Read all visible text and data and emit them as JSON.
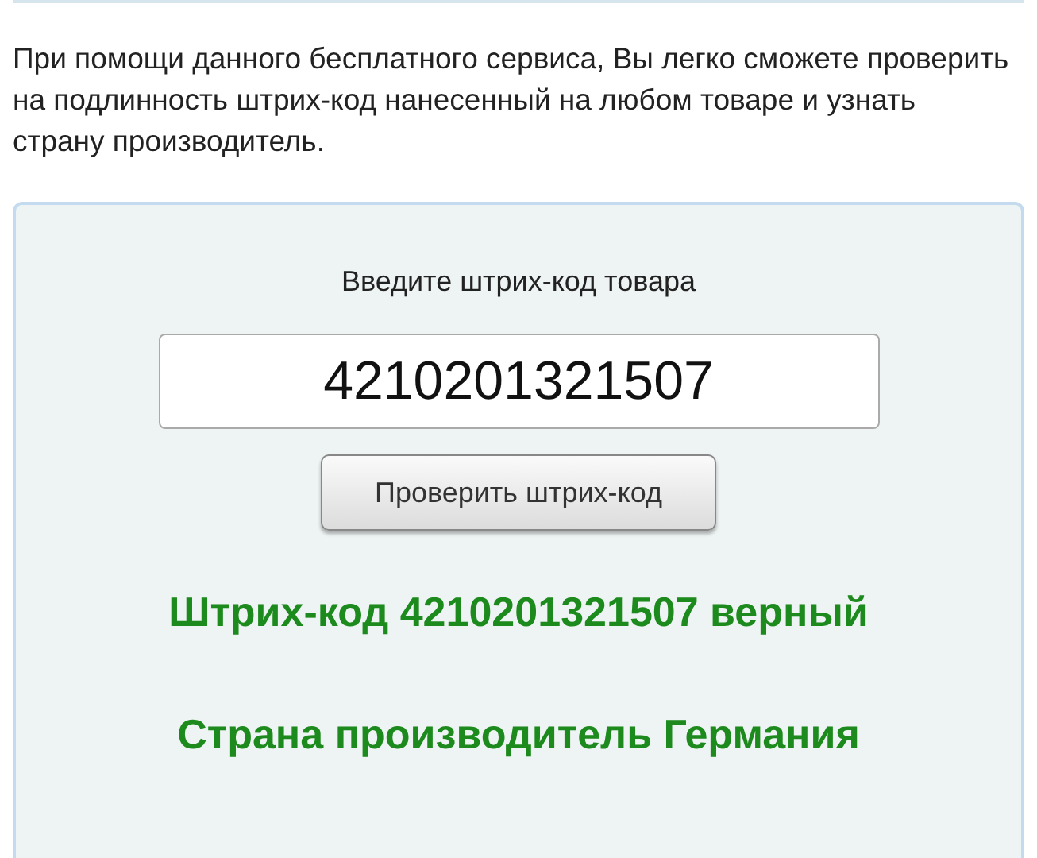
{
  "intro": "При помощи данного бесплатного сервиса, Вы легко сможете проверить на подлинность штрих-код нанесенный на любом товаре и узнать страну производитель.",
  "form": {
    "label": "Введите штрих-код товара",
    "value": "4210201321507",
    "button": "Проверить штрих-код"
  },
  "results": [
    "Штрих-код 4210201321507 верный",
    "Страна производитель Германия"
  ]
}
